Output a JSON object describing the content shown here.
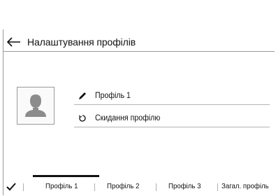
{
  "header": {
    "title": "Налаштування профілів"
  },
  "profile": {
    "avatar_icon": "person-silhouette-icon"
  },
  "menu": {
    "rename_label": "Профіль 1",
    "reset_label": "Скидання профілю"
  },
  "tabs": [
    {
      "label": "Профіль 1",
      "selected": true
    },
    {
      "label": "Профіль 2",
      "selected": false
    },
    {
      "label": "Профіль 3",
      "selected": false
    },
    {
      "label": "Загал. профіль",
      "selected": false
    }
  ],
  "colors": {
    "text": "#111111",
    "divider": "#9a9a9a",
    "avatar_silhouette": "#8c8c8c"
  }
}
